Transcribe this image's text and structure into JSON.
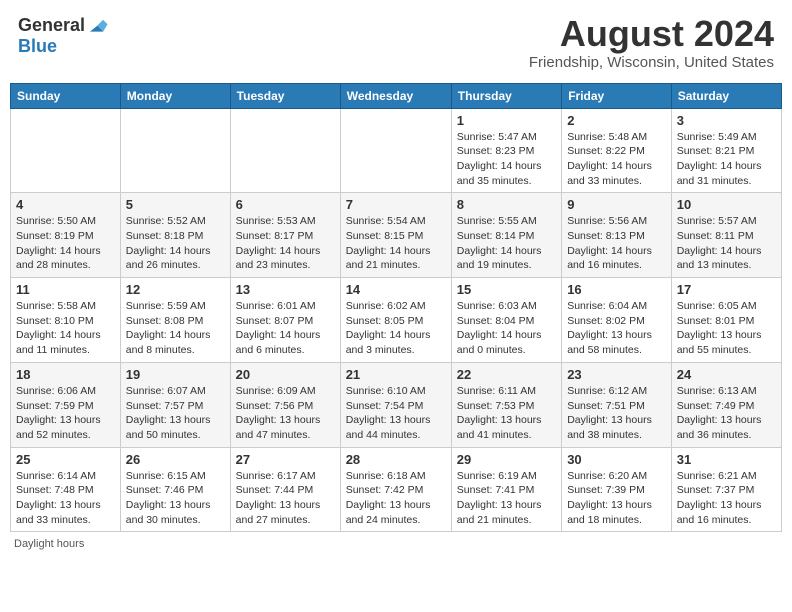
{
  "header": {
    "logo_general": "General",
    "logo_blue": "Blue",
    "month_title": "August 2024",
    "location": "Friendship, Wisconsin, United States"
  },
  "days_of_week": [
    "Sunday",
    "Monday",
    "Tuesday",
    "Wednesday",
    "Thursday",
    "Friday",
    "Saturday"
  ],
  "weeks": [
    [
      {
        "day": "",
        "info": ""
      },
      {
        "day": "",
        "info": ""
      },
      {
        "day": "",
        "info": ""
      },
      {
        "day": "",
        "info": ""
      },
      {
        "day": "1",
        "info": "Sunrise: 5:47 AM\nSunset: 8:23 PM\nDaylight: 14 hours and 35 minutes."
      },
      {
        "day": "2",
        "info": "Sunrise: 5:48 AM\nSunset: 8:22 PM\nDaylight: 14 hours and 33 minutes."
      },
      {
        "day": "3",
        "info": "Sunrise: 5:49 AM\nSunset: 8:21 PM\nDaylight: 14 hours and 31 minutes."
      }
    ],
    [
      {
        "day": "4",
        "info": "Sunrise: 5:50 AM\nSunset: 8:19 PM\nDaylight: 14 hours and 28 minutes."
      },
      {
        "day": "5",
        "info": "Sunrise: 5:52 AM\nSunset: 8:18 PM\nDaylight: 14 hours and 26 minutes."
      },
      {
        "day": "6",
        "info": "Sunrise: 5:53 AM\nSunset: 8:17 PM\nDaylight: 14 hours and 23 minutes."
      },
      {
        "day": "7",
        "info": "Sunrise: 5:54 AM\nSunset: 8:15 PM\nDaylight: 14 hours and 21 minutes."
      },
      {
        "day": "8",
        "info": "Sunrise: 5:55 AM\nSunset: 8:14 PM\nDaylight: 14 hours and 19 minutes."
      },
      {
        "day": "9",
        "info": "Sunrise: 5:56 AM\nSunset: 8:13 PM\nDaylight: 14 hours and 16 minutes."
      },
      {
        "day": "10",
        "info": "Sunrise: 5:57 AM\nSunset: 8:11 PM\nDaylight: 14 hours and 13 minutes."
      }
    ],
    [
      {
        "day": "11",
        "info": "Sunrise: 5:58 AM\nSunset: 8:10 PM\nDaylight: 14 hours and 11 minutes."
      },
      {
        "day": "12",
        "info": "Sunrise: 5:59 AM\nSunset: 8:08 PM\nDaylight: 14 hours and 8 minutes."
      },
      {
        "day": "13",
        "info": "Sunrise: 6:01 AM\nSunset: 8:07 PM\nDaylight: 14 hours and 6 minutes."
      },
      {
        "day": "14",
        "info": "Sunrise: 6:02 AM\nSunset: 8:05 PM\nDaylight: 14 hours and 3 minutes."
      },
      {
        "day": "15",
        "info": "Sunrise: 6:03 AM\nSunset: 8:04 PM\nDaylight: 14 hours and 0 minutes."
      },
      {
        "day": "16",
        "info": "Sunrise: 6:04 AM\nSunset: 8:02 PM\nDaylight: 13 hours and 58 minutes."
      },
      {
        "day": "17",
        "info": "Sunrise: 6:05 AM\nSunset: 8:01 PM\nDaylight: 13 hours and 55 minutes."
      }
    ],
    [
      {
        "day": "18",
        "info": "Sunrise: 6:06 AM\nSunset: 7:59 PM\nDaylight: 13 hours and 52 minutes."
      },
      {
        "day": "19",
        "info": "Sunrise: 6:07 AM\nSunset: 7:57 PM\nDaylight: 13 hours and 50 minutes."
      },
      {
        "day": "20",
        "info": "Sunrise: 6:09 AM\nSunset: 7:56 PM\nDaylight: 13 hours and 47 minutes."
      },
      {
        "day": "21",
        "info": "Sunrise: 6:10 AM\nSunset: 7:54 PM\nDaylight: 13 hours and 44 minutes."
      },
      {
        "day": "22",
        "info": "Sunrise: 6:11 AM\nSunset: 7:53 PM\nDaylight: 13 hours and 41 minutes."
      },
      {
        "day": "23",
        "info": "Sunrise: 6:12 AM\nSunset: 7:51 PM\nDaylight: 13 hours and 38 minutes."
      },
      {
        "day": "24",
        "info": "Sunrise: 6:13 AM\nSunset: 7:49 PM\nDaylight: 13 hours and 36 minutes."
      }
    ],
    [
      {
        "day": "25",
        "info": "Sunrise: 6:14 AM\nSunset: 7:48 PM\nDaylight: 13 hours and 33 minutes."
      },
      {
        "day": "26",
        "info": "Sunrise: 6:15 AM\nSunset: 7:46 PM\nDaylight: 13 hours and 30 minutes."
      },
      {
        "day": "27",
        "info": "Sunrise: 6:17 AM\nSunset: 7:44 PM\nDaylight: 13 hours and 27 minutes."
      },
      {
        "day": "28",
        "info": "Sunrise: 6:18 AM\nSunset: 7:42 PM\nDaylight: 13 hours and 24 minutes."
      },
      {
        "day": "29",
        "info": "Sunrise: 6:19 AM\nSunset: 7:41 PM\nDaylight: 13 hours and 21 minutes."
      },
      {
        "day": "30",
        "info": "Sunrise: 6:20 AM\nSunset: 7:39 PM\nDaylight: 13 hours and 18 minutes."
      },
      {
        "day": "31",
        "info": "Sunrise: 6:21 AM\nSunset: 7:37 PM\nDaylight: 13 hours and 16 minutes."
      }
    ]
  ],
  "footer": {
    "note": "Daylight hours"
  }
}
